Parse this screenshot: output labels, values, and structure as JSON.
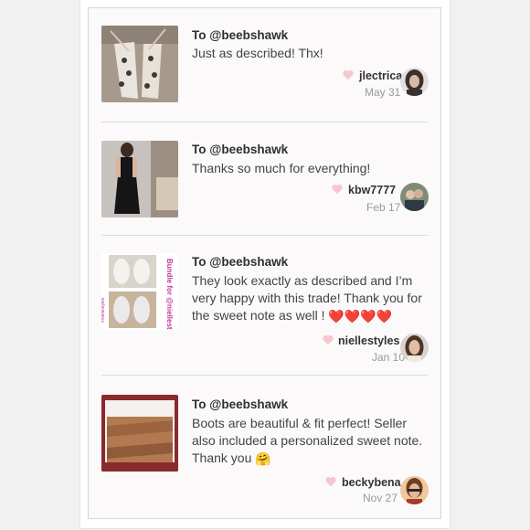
{
  "reviews": [
    {
      "to": "To @beebshawk",
      "text": "Just as described! Thx!",
      "user": "jlectrica",
      "date": "May 31"
    },
    {
      "to": "To @beebshawk",
      "text": "Thanks so much for everything!",
      "user": "kbw7777",
      "date": "Feb 17"
    },
    {
      "to": "To @beebshawk",
      "text_lines": [
        "They look exactly as described and I’m",
        "very happy with this trade! Thank you for",
        "the sweet note as well !"
      ],
      "emoji": "❤️❤️❤️❤️",
      "thumb_caption": "Bundle for @niellestyles",
      "user": "niellestyles",
      "date": "Jan 10"
    },
    {
      "to": "To @beebshawk",
      "text_lines": [
        "Boots are beautiful & fit perfect! Seller",
        "also included a personalized sweet note.",
        "Thank you"
      ],
      "emoji": "🤗",
      "user": "beckybena",
      "date": "Nov 27"
    }
  ],
  "icons": {
    "like": "heart-icon"
  },
  "colors": {
    "heart": "#f7c7cf",
    "accent_caption": "#c0399b"
  }
}
